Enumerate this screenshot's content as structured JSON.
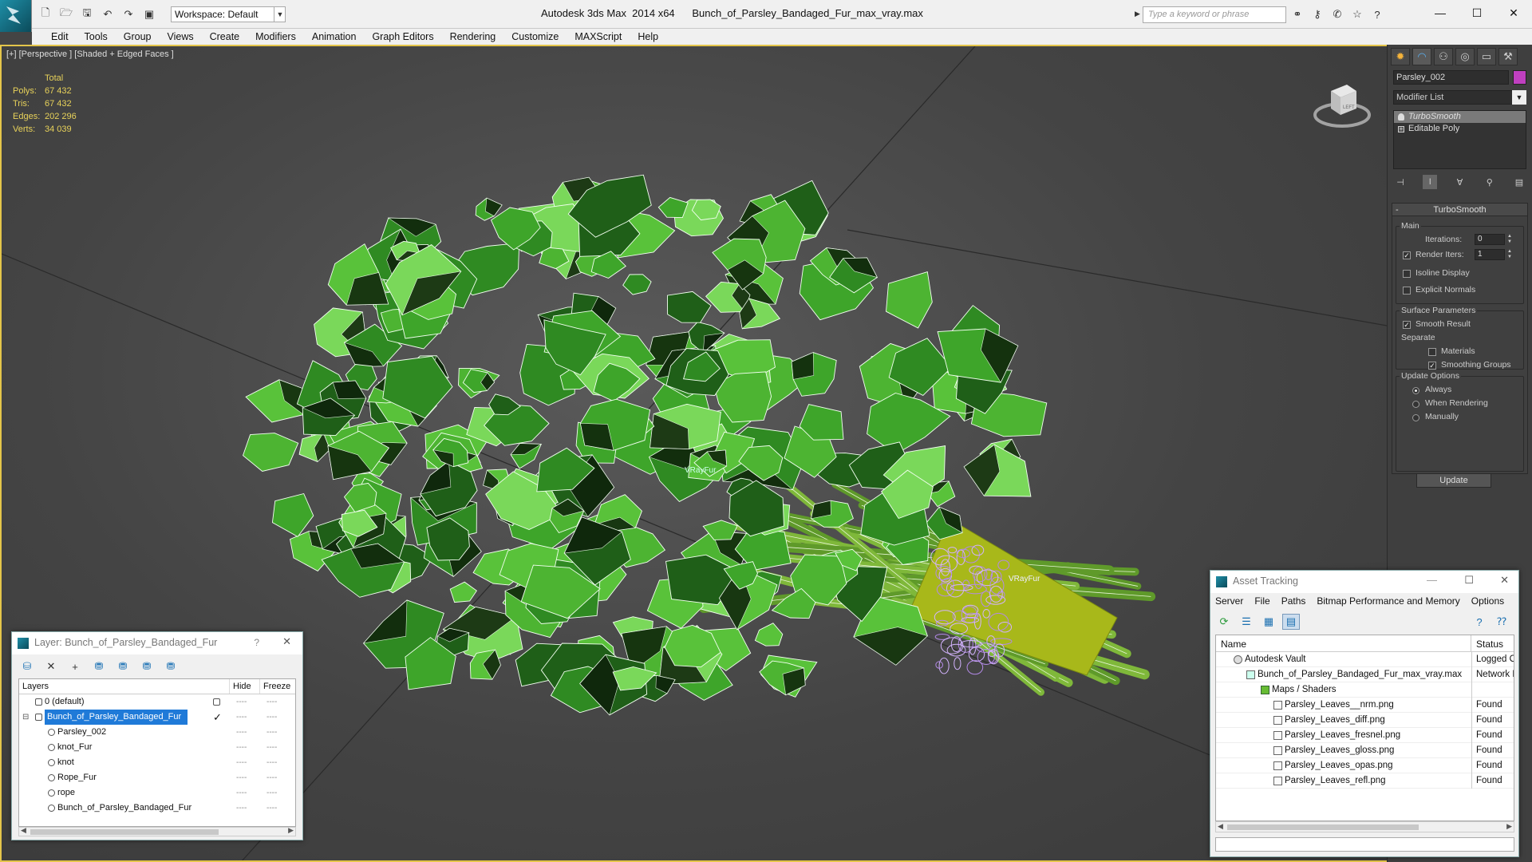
{
  "titlebar": {
    "workspace": "Workspace: Default",
    "app_title": "Autodesk 3ds Max  2014 x64",
    "file_name": "Bunch_of_Parsley_Bandaged_Fur_max_vray.max",
    "search_placeholder": "Type a keyword or phrase"
  },
  "menu": [
    "Edit",
    "Tools",
    "Group",
    "Views",
    "Create",
    "Modifiers",
    "Animation",
    "Graph Editors",
    "Rendering",
    "Customize",
    "MAXScript",
    "Help"
  ],
  "viewport": {
    "label": "[+] [Perspective ] [Shaded + Edged Faces ]",
    "stats": {
      "total_label": "Total",
      "rows": [
        {
          "key": "Polys:",
          "value": "67 432"
        },
        {
          "key": "Tris:",
          "value": "67 432"
        },
        {
          "key": "Edges:",
          "value": "202 296"
        },
        {
          "key": "Verts:",
          "value": "34 039"
        }
      ]
    },
    "fur_label_1": "VRayFur",
    "fur_label_2": "VRayFur",
    "viewcube_label": "LEFT"
  },
  "command_panel": {
    "object_name": "Parsley_002",
    "object_color": "#c040c0",
    "modifier_list": "Modifier List",
    "stack": [
      {
        "label": "TurboSmooth",
        "selected": true
      },
      {
        "label": "Editable Poly",
        "selected": false
      }
    ],
    "turbosmooth": {
      "title": "TurboSmooth",
      "main_label": "Main",
      "iterations_label": "Iterations:",
      "iterations_value": "0",
      "render_iters_label": "Render Iters:",
      "render_iters_value": "1",
      "isoline_label": "Isoline Display",
      "explicit_label": "Explicit Normals",
      "surface_label": "Surface Parameters",
      "smooth_label": "Smooth Result",
      "separate_label": "Separate",
      "materials_label": "Materials",
      "smoothing_groups_label": "Smoothing Groups",
      "update_options_label": "Update Options",
      "always_label": "Always",
      "when_rendering_label": "When Rendering",
      "manually_label": "Manually",
      "update_button": "Update"
    }
  },
  "layer_dialog": {
    "title": "Layer: Bunch_of_Parsley_Bandaged_Fur",
    "help": "?",
    "columns": {
      "layers": "Layers",
      "hide": "Hide",
      "freeze": "Freeze"
    },
    "rows": [
      {
        "name": "0 (default)",
        "indent": 0,
        "selected": false
      },
      {
        "name": "Bunch_of_Parsley_Bandaged_Fur",
        "indent": 0,
        "selected": true
      },
      {
        "name": "Parsley_002",
        "indent": 1,
        "selected": false
      },
      {
        "name": "knot_Fur",
        "indent": 1,
        "selected": false
      },
      {
        "name": "knot",
        "indent": 1,
        "selected": false
      },
      {
        "name": "Rope_Fur",
        "indent": 1,
        "selected": false
      },
      {
        "name": "rope",
        "indent": 1,
        "selected": false
      },
      {
        "name": "Bunch_of_Parsley_Bandaged_Fur",
        "indent": 1,
        "selected": false
      }
    ]
  },
  "asset_dialog": {
    "title": "Asset Tracking",
    "menu": [
      "Server",
      "File",
      "Paths",
      "Bitmap Performance and Memory",
      "Options"
    ],
    "columns": {
      "name": "Name",
      "status": "Status"
    },
    "rows": [
      {
        "name": "Autodesk Vault",
        "status": "Logged Ou",
        "indent": 0
      },
      {
        "name": "Bunch_of_Parsley_Bandaged_Fur_max_vray.max",
        "status": "Network Pa",
        "indent": 1
      },
      {
        "name": "Maps / Shaders",
        "status": "",
        "indent": 2
      },
      {
        "name": "Parsley_Leaves__nrm.png",
        "status": "Found",
        "indent": 3
      },
      {
        "name": "Parsley_Leaves_diff.png",
        "status": "Found",
        "indent": 3
      },
      {
        "name": "Parsley_Leaves_fresnel.png",
        "status": "Found",
        "indent": 3
      },
      {
        "name": "Parsley_Leaves_gloss.png",
        "status": "Found",
        "indent": 3
      },
      {
        "name": "Parsley_Leaves_opas.png",
        "status": "Found",
        "indent": 3
      },
      {
        "name": "Parsley_Leaves_refl.png",
        "status": "Found",
        "indent": 3
      }
    ]
  }
}
